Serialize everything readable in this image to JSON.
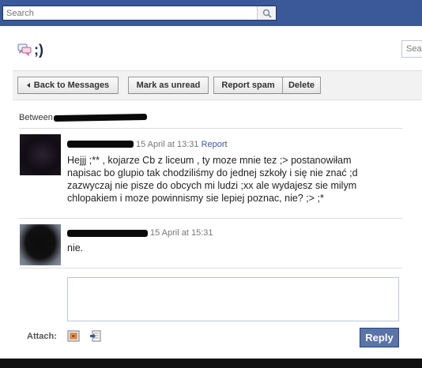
{
  "topbar": {
    "search_placeholder": "Search"
  },
  "header": {
    "title": ";)",
    "right_search_text": "Sea"
  },
  "actions": {
    "back_label": "Back to Messages",
    "mark_unread_label": "Mark as unread",
    "report_spam_label": "Report spam",
    "delete_label": "Delete"
  },
  "thread": {
    "between_label": "Between"
  },
  "messages": [
    {
      "timestamp": "15 April at 13:31",
      "report_label": "Report",
      "lines": [
        "Hejjj ;** , kojarze Cb z liceum , ty moze mnie tez ;> postanowiłam",
        "napisac bo glupio tak chodziliśmy do jednej szkoły i się nie znać ;d",
        "zazwyczaj nie pisze do obcych mi ludzi ;xx ale wydajesz sie milym",
        "chlopakiem i moze powinnismy sie lepiej poznac, nie? ;> ;*"
      ]
    },
    {
      "timestamp": "15 April at 15:31",
      "lines": [
        "nie."
      ]
    }
  ],
  "composer": {
    "attach_label": "Attach:",
    "reply_label": "Reply"
  },
  "icons": {
    "search": "magnifier-icon",
    "messages": "speech-bubbles-icon",
    "attach_photo": "photo-icon",
    "attach_link": "link-icon",
    "back": "left-triangle-icon"
  },
  "colors": {
    "brand": "#3b5998",
    "reply_button": "#5b74a8"
  }
}
